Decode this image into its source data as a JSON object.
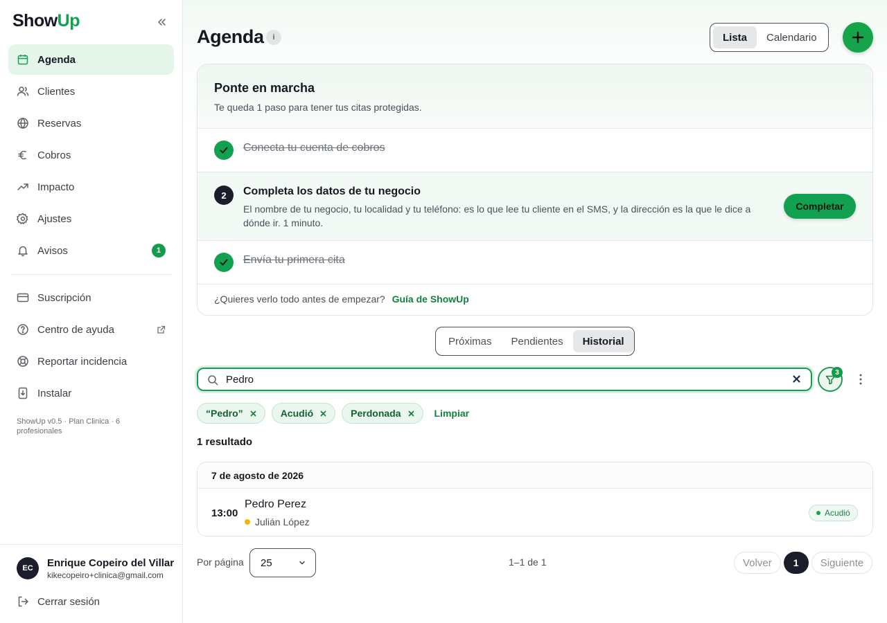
{
  "app": {
    "logo_a": "Show",
    "logo_b": "Up"
  },
  "sidebar": {
    "items": [
      {
        "label": "Agenda",
        "icon": "calendar-icon"
      },
      {
        "label": "Clientes",
        "icon": "users-icon"
      },
      {
        "label": "Reservas",
        "icon": "globe-icon"
      },
      {
        "label": "Cobros",
        "icon": "euro-icon"
      },
      {
        "label": "Impacto",
        "icon": "trending-up-icon"
      },
      {
        "label": "Ajustes",
        "icon": "gear-icon"
      },
      {
        "label": "Avisos",
        "icon": "bell-icon",
        "badge": "1"
      }
    ],
    "secondary": [
      {
        "label": "Suscripción",
        "icon": "credit-card-icon"
      },
      {
        "label": "Centro de ayuda",
        "icon": "help-circle-icon"
      },
      {
        "label": "Reportar incidencia",
        "icon": "lifebuoy-icon"
      },
      {
        "label": "Instalar",
        "icon": "install-icon"
      }
    ],
    "version": "ShowUp v0.5 · Plan Clinica · 6 profesionales",
    "user": {
      "initials": "EC",
      "name": "Enrique Copeiro del Villar",
      "email": "kikecopeiro+clinica@gmail.com"
    },
    "logout": "Cerrar sesión"
  },
  "header": {
    "title": "Agenda",
    "info": "i",
    "views": [
      "Lista",
      "Calendario"
    ],
    "active_view": "Lista"
  },
  "onboarding": {
    "title": "Ponte en marcha",
    "subtitle": "Te queda 1 paso para tener tus citas protegidas.",
    "step1": "Conecta tu cuenta de cobros",
    "step2_num": "2",
    "step2_title": "Completa los datos de tu negocio",
    "step2_desc": "El nombre de tu negocio, tu localidad y tu teléfono: es lo que lee tu cliente en el SMS, y la dirección es la que le dice a dónde ir. 1 minuto.",
    "step2_button": "Completar",
    "step3": "Envía tu primera cita",
    "footer_text": "¿Quieres verlo todo antes de empezar?",
    "footer_link": "Guía de ShowUp"
  },
  "tabs": [
    "Próximas",
    "Pendientes",
    "Historial"
  ],
  "active_tab": "Historial",
  "search": {
    "value": "Pedro"
  },
  "filter_count": "3",
  "chips": [
    "“Pedro”",
    "Acudió",
    "Perdonada"
  ],
  "clear_label": "Limpiar",
  "results_text": "1 resultado",
  "appointments": {
    "date": "7 de agosto de 2026",
    "items": [
      {
        "time": "13:00",
        "client": "Pedro Perez",
        "professional": "Julián López",
        "status": "Acudió"
      }
    ]
  },
  "pagination": {
    "per_page_label": "Por página",
    "per_page": "25",
    "range": "1–1 de 1",
    "prev": "Volver",
    "current": "1",
    "next": "Siguiente"
  },
  "colors": {
    "brand": "#12a150",
    "dark": "#1b1d2b",
    "pro_dot": "#f2b705"
  }
}
